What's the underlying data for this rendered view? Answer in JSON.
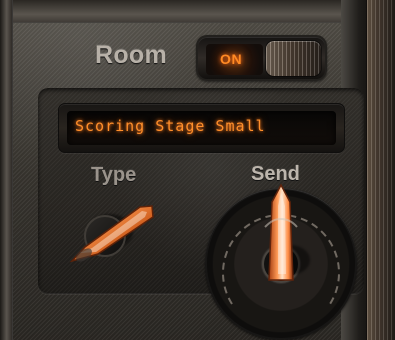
{
  "plugin": {
    "room_label": "Room",
    "room_toggle_label": "ON",
    "preset_display": "Scoring Stage Small",
    "type_label": "Type",
    "send_label": "Send"
  },
  "icons": {
    "room_toggle_knob": "toggle-switch-icon",
    "type_knob": "rotary-knob-icon",
    "send_knob": "rotary-knob-icon"
  },
  "colors": {
    "accent": "#ff8a24",
    "panel": "#3a3630",
    "text": "#b8b1a8"
  }
}
